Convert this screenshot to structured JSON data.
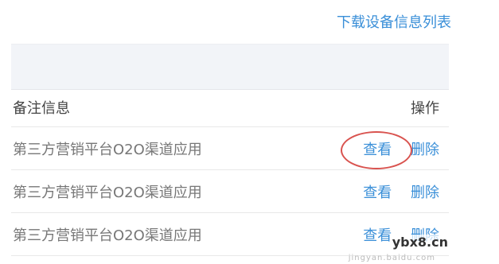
{
  "toolbar": {
    "download_label": "下载设备信息列表"
  },
  "table": {
    "headers": {
      "note": "备注信息",
      "ops": "操作"
    },
    "rows": [
      {
        "note": "第三方营销平台O2O渠道应用",
        "view": "查看",
        "delete": "删除",
        "highlighted": true
      },
      {
        "note": "第三方营销平台O2O渠道应用",
        "view": "查看",
        "delete": "删除"
      },
      {
        "note": "第三方营销平台O2O渠道应用",
        "view": "查看",
        "delete": "删除"
      }
    ]
  },
  "watermark": {
    "text": "ybx8.cn",
    "sub": "jingyan.baidu.com"
  },
  "colors": {
    "link": "#3a8fd8",
    "highlight": "#d9534f",
    "band": "#f2f4f8"
  }
}
